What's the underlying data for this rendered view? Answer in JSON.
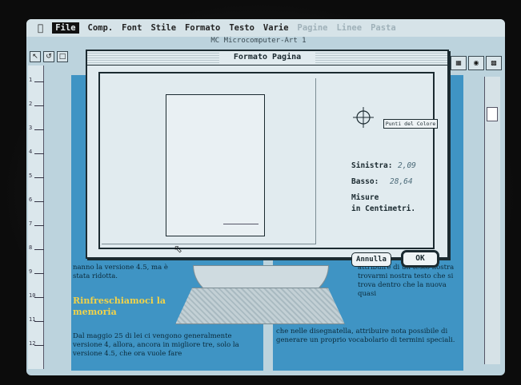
{
  "menubar": {
    "apple": "",
    "file": "File",
    "comp": "Comp.",
    "font": "Font",
    "stile": "Stile",
    "formato": "Formato",
    "testo": "Testo",
    "varie": "Varie",
    "dim1": "Pagine",
    "dim2": "Linee",
    "dim3": "Pasta"
  },
  "document": {
    "title": "MC Microcomputer-Art 1"
  },
  "dialog": {
    "title": "Formato Pagina",
    "zero_button": "Punti del Colore",
    "sinistra_label": "Sinistra:",
    "sinistra_value": "2,09",
    "basso_label": "Basso:",
    "basso_value": "28,64",
    "misure_line1": "Misure",
    "misure_line2": "in Centimetri.",
    "annulla_label": "Annulla",
    "ok_label": "OK"
  },
  "page_behind": {
    "heading": "Rinfreschiamoci la memoria",
    "left_text_1": "nanno la versione 4.5, ma è stata ridotta.",
    "left_text_2": "Dal maggio 25 di lei ci vengono generalmente versione 4, allora, ancora in migliore tre, solo la versione 4.5, che ora vuole fare",
    "right_text_1": "attribuire di un testo nostra trovarmi nostra testo che si trova dentro che la nuova quasi",
    "right_text_2": "che nelle disegnatella, attribuire nota possibile di generare un proprio vocabolario di termini speciali."
  }
}
